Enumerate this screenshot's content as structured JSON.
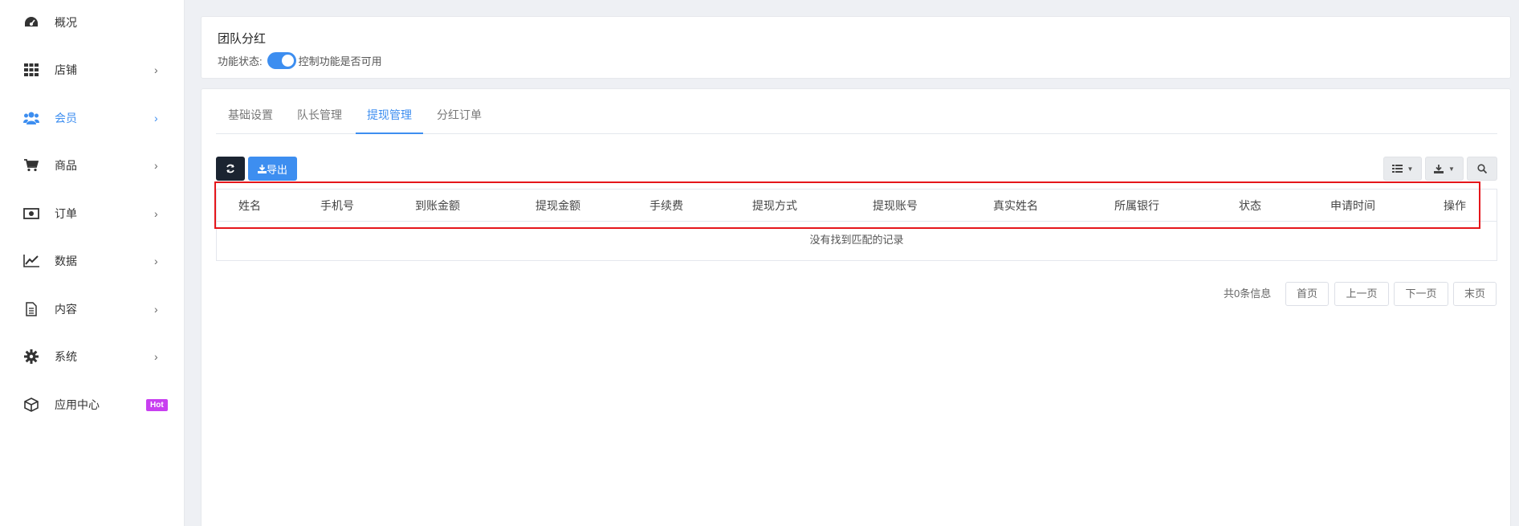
{
  "sidebar": {
    "items": [
      {
        "label": "概况",
        "icon": "dashboard-icon",
        "arrow": ""
      },
      {
        "label": "店铺",
        "icon": "grid-icon",
        "arrow": "›"
      },
      {
        "label": "会员",
        "icon": "users-icon",
        "arrow": "›"
      },
      {
        "label": "商品",
        "icon": "cart-icon",
        "arrow": "›"
      },
      {
        "label": "订单",
        "icon": "money-icon",
        "arrow": "›"
      },
      {
        "label": "数据",
        "icon": "chart-icon",
        "arrow": "›"
      },
      {
        "label": "内容",
        "icon": "document-icon",
        "arrow": "›"
      },
      {
        "label": "系统",
        "icon": "gear-icon",
        "arrow": "›"
      },
      {
        "label": "应用中心",
        "icon": "cube-icon",
        "badge": "Hot"
      }
    ]
  },
  "header": {
    "title": "团队分红",
    "status_label": "功能状态:",
    "toggle_on": true,
    "toggle_desc": "控制功能是否可用"
  },
  "tabs": [
    {
      "label": "基础设置"
    },
    {
      "label": "队长管理"
    },
    {
      "label": "提现管理"
    },
    {
      "label": "分红订单"
    }
  ],
  "toolbar": {
    "export_label": "导出"
  },
  "table": {
    "columns": [
      "姓名",
      "手机号",
      "到账金额",
      "提现金额",
      "手续费",
      "提现方式",
      "提现账号",
      "真实姓名",
      "所属银行",
      "状态",
      "申请时间",
      "操作"
    ],
    "empty_text": "没有找到匹配的记录"
  },
  "pagination": {
    "info": "共0条信息",
    "first": "首页",
    "prev": "上一页",
    "next": "下一页",
    "last": "末页"
  },
  "colors": {
    "accent": "#3d8ef0",
    "highlight": "#e5161b",
    "hot_badge": "#c83ff0"
  }
}
